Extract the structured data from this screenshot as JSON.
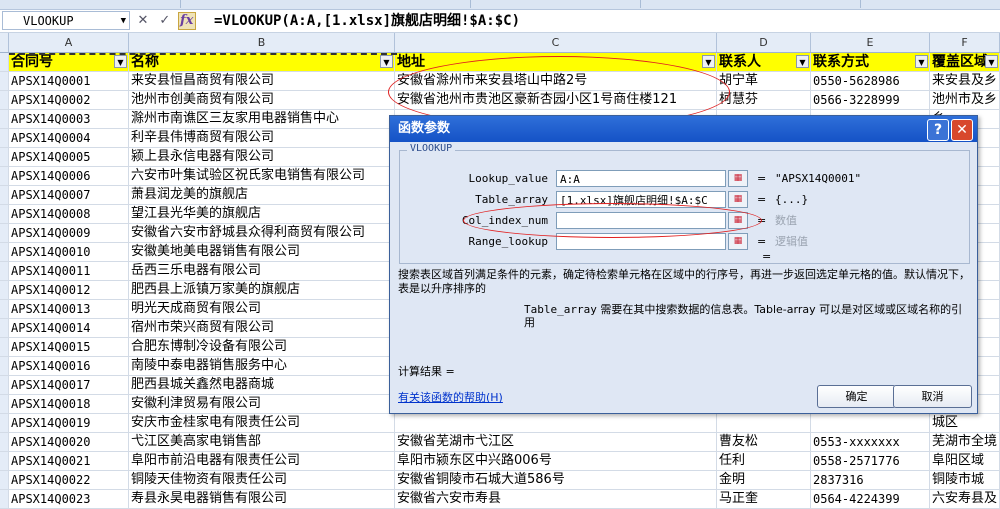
{
  "formula_bar": {
    "name_box": "VLOOKUP",
    "cancel_glyph": "✕",
    "confirm_glyph": "✓",
    "fx_label": "fx",
    "formula": "=VLOOKUP(A:A,[1.xlsx]旗舰店明细!$A:$C)"
  },
  "columns": [
    "A",
    "B",
    "C",
    "D",
    "E",
    "F"
  ],
  "headers": [
    "合同号",
    "名称",
    "地址",
    "联系人",
    "联系方式",
    "覆盖区域"
  ],
  "rows": [
    [
      "APSX14Q0001",
      "来安县恒昌商贸有限公司",
      "安徽省滁州市来安县塔山中路2号",
      "胡宁革",
      "0550-5628986",
      "来安县及乡"
    ],
    [
      "APSX14Q0002",
      "池州市创美商贸有限公司",
      "安徽省池州市贵池区豪新杏园小区1号商住楼121",
      "柯慧芬",
      "0566-3228999",
      "池州市及乡"
    ],
    [
      "APSX14Q0003",
      "滁州市南谯区三友家用电器销售中心",
      "",
      "",
      "",
      "乡"
    ],
    [
      "APSX14Q0004",
      "利辛县伟博商贸有限公司",
      "",
      "",
      "",
      "乡"
    ],
    [
      "APSX14Q0005",
      "颍上县永信电器有限公司",
      "",
      "",
      "",
      "乡"
    ],
    [
      "APSX14Q0006",
      "六安市叶集试验区祝氏家电销售有限公司",
      "",
      "",
      "",
      "区及"
    ],
    [
      "APSX14Q0007",
      "萧县润龙美的旗舰店",
      "",
      "",
      "",
      "乡镇"
    ],
    [
      "APSX14Q0008",
      "望江县光华美的旗舰店",
      "",
      "",
      "",
      "乡镇"
    ],
    [
      "APSX14Q0009",
      "安徽省六安市舒城县众得利商贸有限公司",
      "",
      "",
      "",
      "城及"
    ],
    [
      "APSX14Q0010",
      "安徽美地美电器销售有限公司",
      "",
      "",
      "",
      "及三"
    ],
    [
      "APSX14Q0011",
      "岳西三乐电器有限公司",
      "",
      "",
      "",
      "城及"
    ],
    [
      "APSX14Q0012",
      "肥西县上派镇万家美的旗舰店",
      "",
      "",
      "",
      "城及"
    ],
    [
      "APSX14Q0013",
      "明光天成商贸有限公司",
      "",
      "",
      "",
      "区及"
    ],
    [
      "APSX14Q0014",
      "宿州市荣兴商贸有限公司",
      "",
      "",
      "",
      "、涌"
    ],
    [
      "APSX14Q0015",
      "合肥东博制冷设备有限公司",
      "",
      "",
      "",
      "区"
    ],
    [
      "APSX14Q0016",
      "南陵中泰电器销售服务中心",
      "",
      "",
      "",
      "城区"
    ],
    [
      "APSX14Q0017",
      "肥西县城关鑫然电器商城",
      "",
      "",
      "",
      "城及"
    ],
    [
      "APSX14Q0018",
      "安徽利津贸易有限公司",
      "",
      "",
      "",
      "及乡"
    ],
    [
      "APSX14Q0019",
      "安庆市金桂家电有限责任公司",
      "",
      "",
      "",
      "城区"
    ],
    [
      "APSX14Q0020",
      "弋江区美高家电销售部",
      "安徽省芜湖市弋江区",
      "曹友松",
      "0553-xxxxxxx",
      "芜湖市全境"
    ],
    [
      "APSX14Q0021",
      "阜阳市前沿电器有限责任公司",
      "阜阳市颍东区中兴路006号",
      "任利",
      "0558-2571776",
      "阜阳区域"
    ],
    [
      "APSX14Q0022",
      "铜陵天佳物资有限责任公司",
      "安徽省铜陵市石城大道586号",
      "金明",
      "2837316",
      "铜陵市城"
    ],
    [
      "APSX14Q0023",
      "寿县永昊电器销售有限公司",
      "安徽省六安市寿县",
      "马正奎",
      "0564-4224399",
      "六安寿县及"
    ]
  ],
  "dialog": {
    "title": "函数参数",
    "help_glyph": "?",
    "close_glyph": "✕",
    "group_label": "VLOOKUP",
    "args": [
      {
        "label": "Lookup_value",
        "value": "A:A",
        "result": "\"APSX14Q0001\""
      },
      {
        "label": "Table_array",
        "value": "[1.xlsx]旗舰店明细!$A:$C",
        "result": "{...}"
      },
      {
        "label": "Col_index_num",
        "value": "",
        "result": "数值"
      },
      {
        "label": "Range_lookup",
        "value": "",
        "result": "逻辑值"
      }
    ],
    "equals": "=",
    "description": "搜索表区域首列满足条件的元素，确定待检索单元格在区域中的行序号，再进一步返回选定单元格的值。默认情况下，表是以升序排序的",
    "param_name": "Table_array",
    "param_desc": "需要在其中搜索数据的信息表。Table-array 可以是对区域或区域名称的引用",
    "calc_label": "计算结果 =",
    "help_link": "有关该函数的帮助(H)",
    "ok_label": "确定",
    "cancel_label": "取消"
  }
}
